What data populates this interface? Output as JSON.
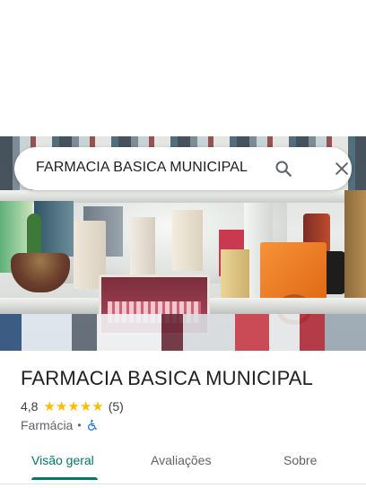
{
  "search": {
    "query": "FARMACIA BASICA MUNICIPAL",
    "search_icon": "search-icon",
    "clear_icon": "close-icon"
  },
  "place": {
    "name": "FARMACIA BASICA MUNICIPAL",
    "rating": "4,8",
    "stars_filled": 5,
    "stars_total": 5,
    "star_glyph": "★",
    "review_count": "(5)",
    "category": "Farmácia",
    "separator": "•",
    "accessibility_icon": "wheelchair-icon"
  },
  "tabs": [
    {
      "label": "Visão geral",
      "selected": true
    },
    {
      "label": "Avaliações",
      "selected": false
    },
    {
      "label": "Sobre",
      "selected": false
    }
  ],
  "colors": {
    "accent": "#00796b",
    "star": "#fbbc04",
    "wheelchair": "#1a73e8",
    "text_primary": "#202124",
    "text_secondary": "#5f6368"
  }
}
